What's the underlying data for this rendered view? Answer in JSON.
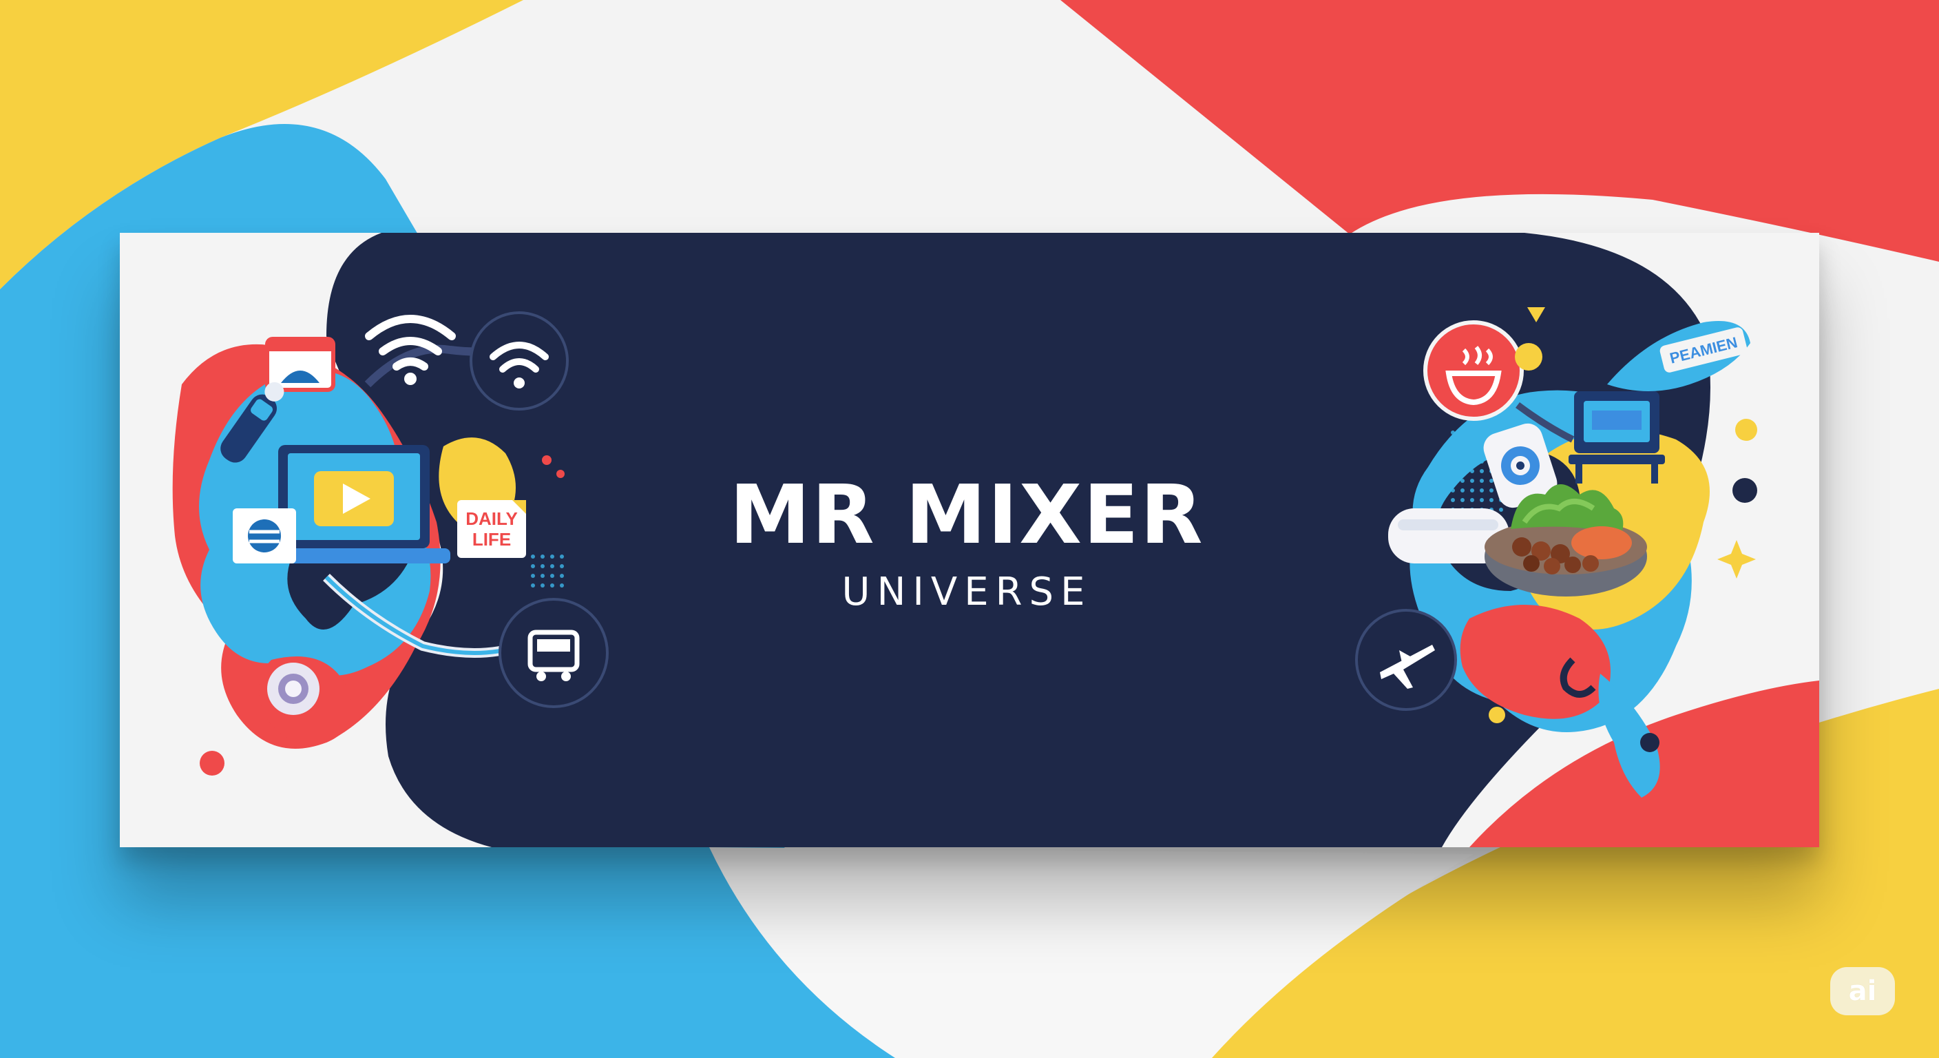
{
  "banner": {
    "title": "MR MIXER",
    "subtitle": "UNIVERSE"
  },
  "left_cluster": {
    "daily_life_line1": "DAILY",
    "daily_life_line2": "LIFE"
  },
  "right_cluster": {
    "tag_label": "PEAMIEN"
  },
  "watermark": {
    "label": "ai"
  },
  "icons": [
    "wifi-icon",
    "play-icon",
    "laptop-icon",
    "bus-icon",
    "hot-bowl-icon",
    "airplane-icon",
    "monitor-icon",
    "headset-icon",
    "food-bowl-icon",
    "browser-window-icon"
  ],
  "colors": {
    "navy": "#1e2848",
    "red": "#ef4a4a",
    "yellow": "#f7d040",
    "sky_blue": "#3cb4e8",
    "white": "#f4f4f4"
  }
}
